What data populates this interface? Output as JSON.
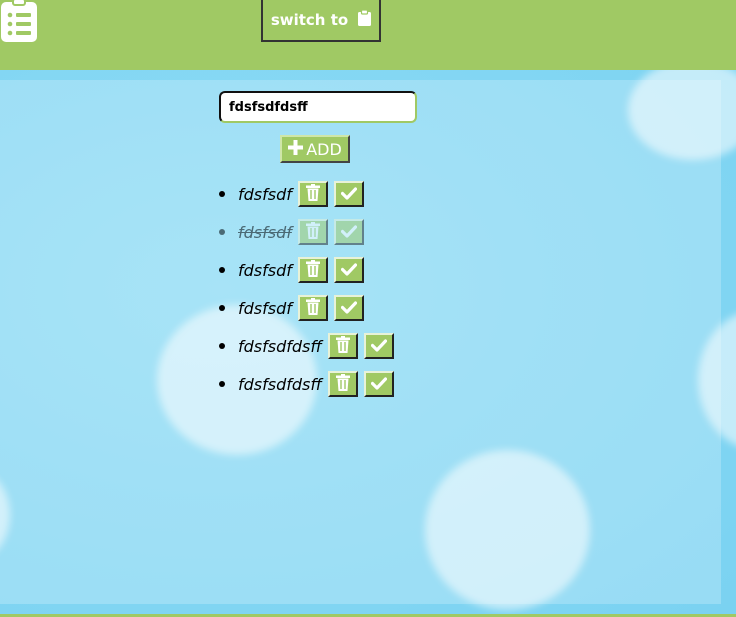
{
  "header": {
    "switch_label": "switch to"
  },
  "form": {
    "input_value": "fdsfsdfdsff",
    "add_label": "ADD"
  },
  "todos": [
    {
      "text": "fdsfsdf",
      "completed": false
    },
    {
      "text": "fdsfsdf",
      "completed": true
    },
    {
      "text": "fdsfsdf",
      "completed": false
    },
    {
      "text": "fdsfsdf",
      "completed": false
    },
    {
      "text": "fdsfsdfdsff",
      "completed": false
    },
    {
      "text": "fdsfsdfdsff",
      "completed": false
    }
  ],
  "icons": {
    "logo": "clipboard-list-icon",
    "switch": "clipboard-icon",
    "add": "plus-icon",
    "delete": "trash-icon",
    "complete": "check-icon"
  },
  "colors": {
    "accent": "#a0c964",
    "background": "#7fd8f3"
  }
}
